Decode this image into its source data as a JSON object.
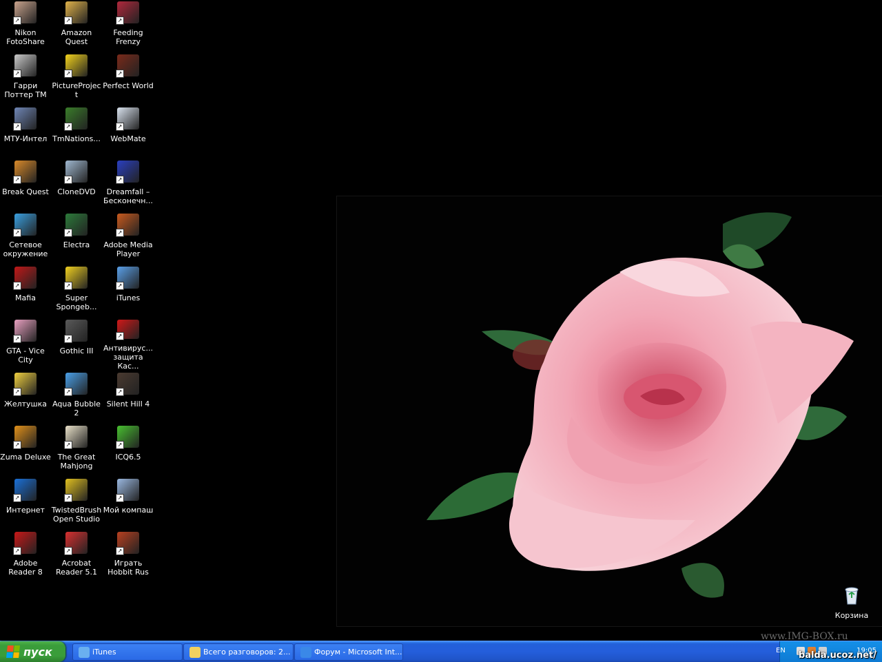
{
  "desktop": {
    "icons": [
      {
        "label": "Nikon FotoShare",
        "icon": "nikon-fotoshare-icon",
        "color": "#c8a28c"
      },
      {
        "label": "Amazon Quest",
        "icon": "amazon-quest-icon",
        "color": "#e0b24a"
      },
      {
        "label": "Feeding Frenzy",
        "icon": "feeding-frenzy-icon",
        "color": "#b0283c"
      },
      {
        "label": "Гарри Поттер ТМ",
        "icon": "harry-potter-icon",
        "color": "#c9c9c9"
      },
      {
        "label": "PictureProject",
        "icon": "pictureproject-icon",
        "color": "#f2d21c"
      },
      {
        "label": "Perfect World",
        "icon": "perfect-world-icon",
        "color": "#7a2a1a"
      },
      {
        "label": "МТУ-Интел",
        "icon": "network-connection-icon",
        "color": "#6f86b6"
      },
      {
        "label": "TmNations...",
        "icon": "tmnations-icon",
        "color": "#3a7d2a"
      },
      {
        "label": "WebMate",
        "icon": "webmate-icon",
        "color": "#d9e2ee"
      },
      {
        "label": "Break Quest",
        "icon": "break-quest-icon",
        "color": "#d98a2a"
      },
      {
        "label": "CloneDVD",
        "icon": "clonedvd-icon",
        "color": "#a0b8d0"
      },
      {
        "label": "Dreamfall – Бесконечн...",
        "icon": "dreamfall-icon",
        "color": "#2a3fc0"
      },
      {
        "label": "Сетевое окружение",
        "icon": "network-places-icon",
        "color": "#3aa0e0"
      },
      {
        "label": "Electra",
        "icon": "electra-icon",
        "color": "#2c7a3a"
      },
      {
        "label": "Adobe Media Player",
        "icon": "adobe-media-player-icon",
        "color": "#c85a1e"
      },
      {
        "label": "Mafia",
        "icon": "mafia-icon",
        "color": "#c01818"
      },
      {
        "label": "Super Spongeb...",
        "icon": "spongebob-icon",
        "color": "#f0d020"
      },
      {
        "label": "iTunes",
        "icon": "itunes-icon",
        "color": "#5aa0e8"
      },
      {
        "label": "GTA - Vice City",
        "icon": "gta-vice-city-icon",
        "color": "#e8a0c0"
      },
      {
        "label": "Gothic III",
        "icon": "gothic-iii-icon",
        "color": "#5a5a5a"
      },
      {
        "label": "Антивирус... защита Кас...",
        "icon": "kaspersky-icon",
        "color": "#d01818"
      },
      {
        "label": "Желтушка",
        "icon": "zheltushka-icon",
        "color": "#f0d040"
      },
      {
        "label": "Aqua Bubble 2",
        "icon": "aqua-bubble-icon",
        "color": "#4aa0e8"
      },
      {
        "label": "Silent Hill 4",
        "icon": "silent-hill-icon",
        "color": "#4a3a30"
      },
      {
        "label": "Zuma Deluxe",
        "icon": "zuma-deluxe-icon",
        "color": "#e0901a"
      },
      {
        "label": "The Great Mahjong",
        "icon": "mahjong-icon",
        "color": "#e8e0c8"
      },
      {
        "label": "ICQ6.5",
        "icon": "icq-icon",
        "color": "#48c030"
      },
      {
        "label": "Интернет",
        "icon": "internet-explorer-icon",
        "color": "#1a70d8"
      },
      {
        "label": "TwistedBrush Open Studio",
        "icon": "twistedbrush-icon",
        "color": "#e0c020"
      },
      {
        "label": "Мой компаш",
        "icon": "my-computer-icon",
        "color": "#9ab8e0"
      },
      {
        "label": "Adobe Reader 8",
        "icon": "adobe-reader-icon",
        "color": "#c81818"
      },
      {
        "label": "Acrobat Reader 5.1",
        "icon": "acrobat-reader-icon",
        "color": "#d83030"
      },
      {
        "label": "Играть Hobbit Rus",
        "icon": "hobbit-icon",
        "color": "#b84020"
      }
    ],
    "recycle_bin": {
      "label": "Корзина",
      "icon": "recycle-bin-icon",
      "color": "#e0e8f0"
    },
    "watermark": "www.IMG-BOX.ru",
    "site_overlay": "balda.ucoz.net/"
  },
  "taskbar": {
    "start_label": "пуск",
    "tasks": [
      {
        "label": "iTunes",
        "icon": "itunes-icon",
        "color": "#6ab0f0"
      },
      {
        "label": "Всего разговоров: 2...",
        "icon": "folder-icon",
        "color": "#f0d060"
      },
      {
        "label": "Форум - Microsoft Int...",
        "icon": "internet-explorer-icon",
        "color": "#3a88e8"
      }
    ],
    "tray": {
      "lang": "EN",
      "clock": "19:05"
    }
  }
}
